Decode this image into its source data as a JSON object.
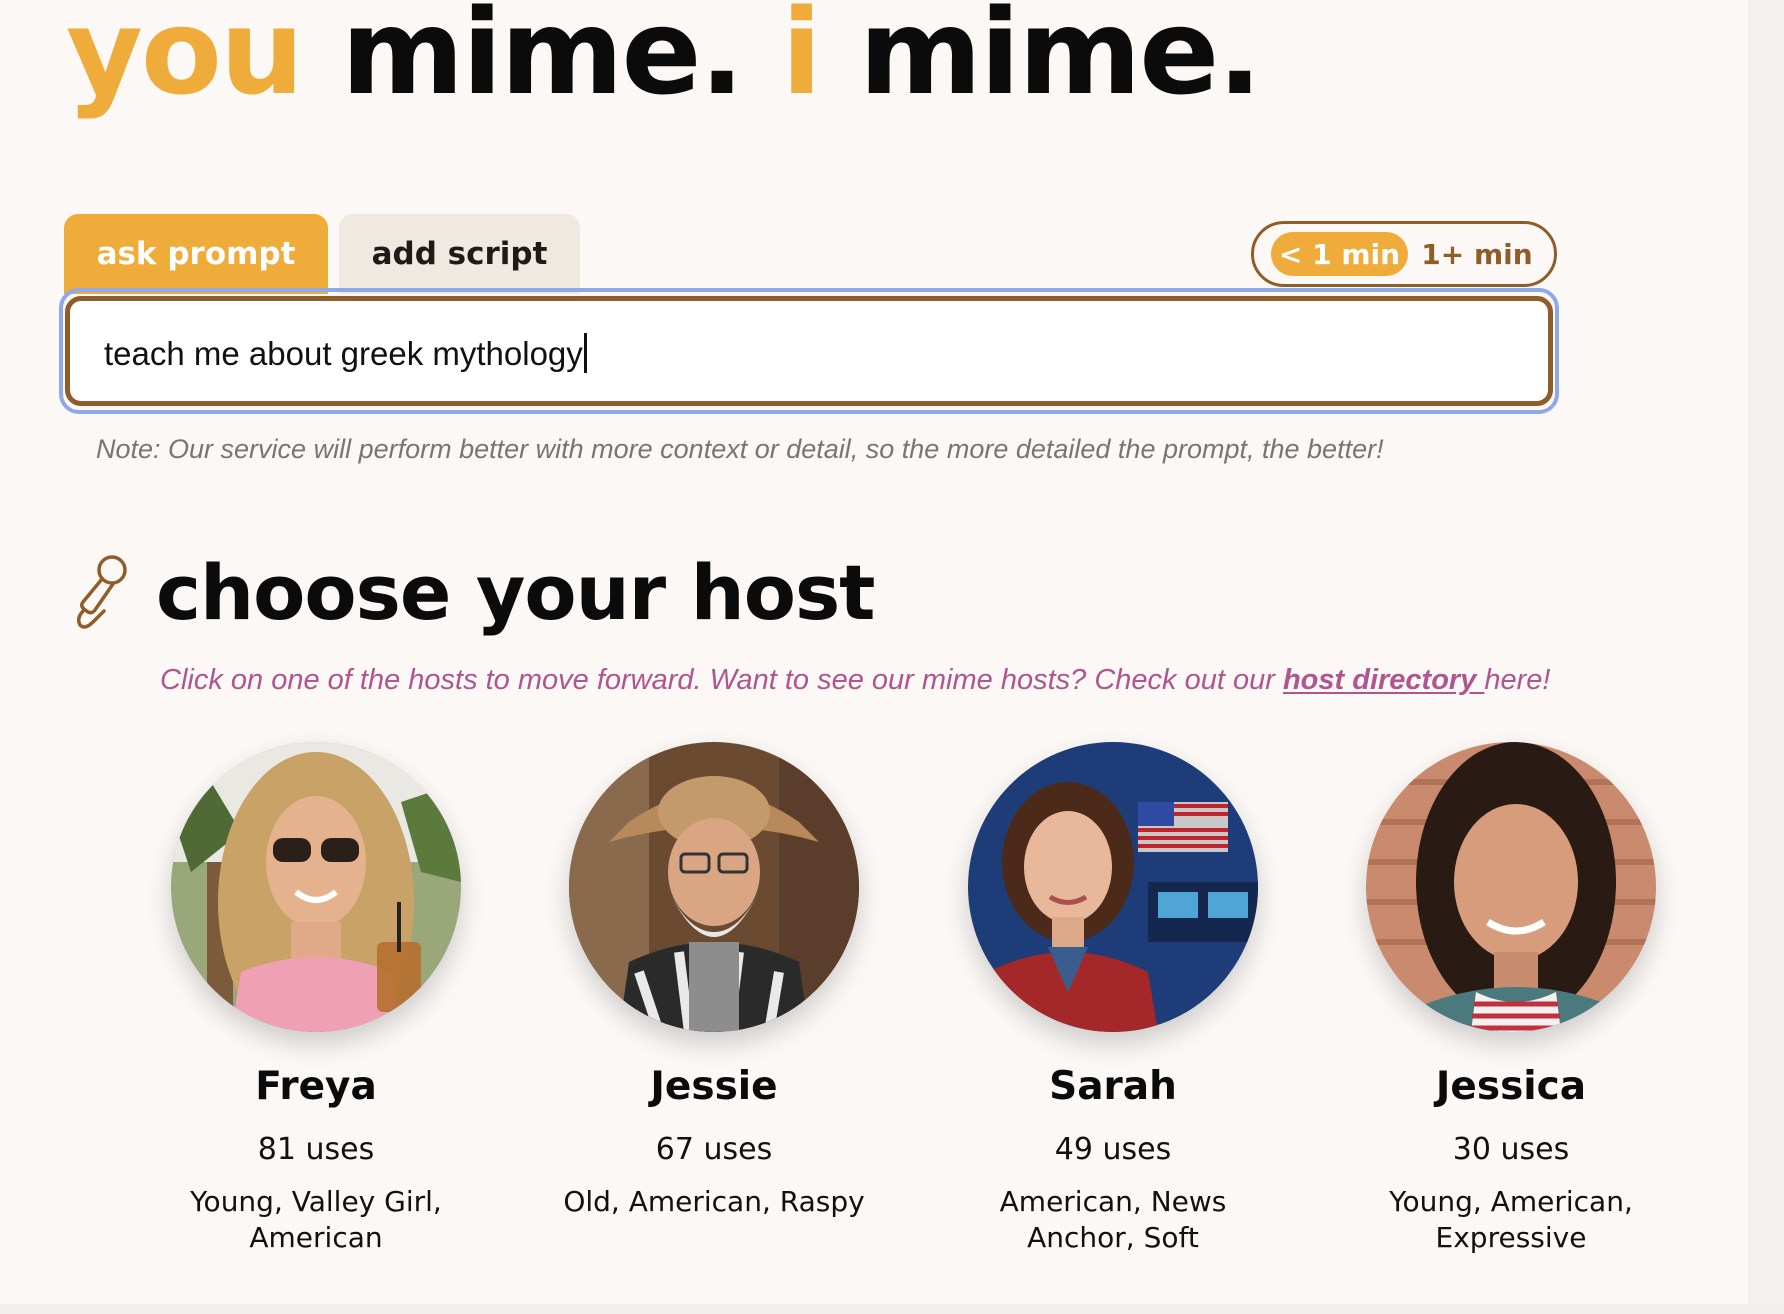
{
  "logo": {
    "you": "you",
    "mime1": "mime.",
    "i": "i",
    "mime2": "mime."
  },
  "tabs": [
    {
      "label": "ask prompt",
      "active": true
    },
    {
      "label": "add script",
      "active": false
    }
  ],
  "duration": {
    "options": [
      "< 1 min",
      "1+ min"
    ],
    "selected": "< 1 min"
  },
  "prompt": {
    "value": "teach me about greek mythology"
  },
  "note": "Note: Our service will perform better with more context or detail, so the more detailed the prompt, the better!",
  "hosts_section": {
    "icon": "microphone-icon",
    "heading": "choose your host",
    "subtitle_before": "Click on one of the hosts to move forward. Want to see our mime hosts? Check out our ",
    "link_text": "host directory ",
    "subtitle_after": "here!"
  },
  "hosts": [
    {
      "name": "Freya",
      "uses": "81 uses",
      "description": "Young, Valley Girl, American"
    },
    {
      "name": "Jessie",
      "uses": "67 uses",
      "description": "Old, American, Raspy"
    },
    {
      "name": "Sarah",
      "uses": "49 uses",
      "description": "American, News Anchor, Soft"
    },
    {
      "name": "Jessica",
      "uses": "30 uses",
      "description": "Young, American, Expressive"
    }
  ],
  "colors": {
    "accent": "#f0ac3a",
    "brown": "#8f5d27",
    "link": "#b0558f",
    "background": "#fbf8f6"
  }
}
